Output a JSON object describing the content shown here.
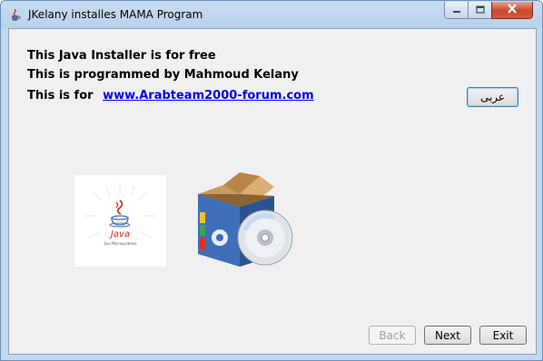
{
  "window": {
    "title": "JKelany installes MAMA Program"
  },
  "info": {
    "line1": "This Java Installer is for free",
    "line2": "This is programmed by Mahmoud Kelany",
    "line3_prefix": "This is for",
    "link_text": "www.Arabteam2000-forum.com"
  },
  "language_button": {
    "label": "عربى"
  },
  "java_logo": {
    "wordmark": "Java",
    "tagline": "Sun Microsystems"
  },
  "navigation": {
    "back_label": "Back",
    "next_label": "Next",
    "exit_label": "Exit"
  },
  "icons": {
    "app": "java-cup-icon",
    "minimize": "minimize-icon",
    "maximize": "maximize-icon",
    "close": "close-icon",
    "box": "software-box-icon"
  },
  "colors": {
    "link": "#0000ee",
    "close_button": "#c9462c",
    "java_red": "#d8231a",
    "java_blue": "#4a6fa5"
  }
}
